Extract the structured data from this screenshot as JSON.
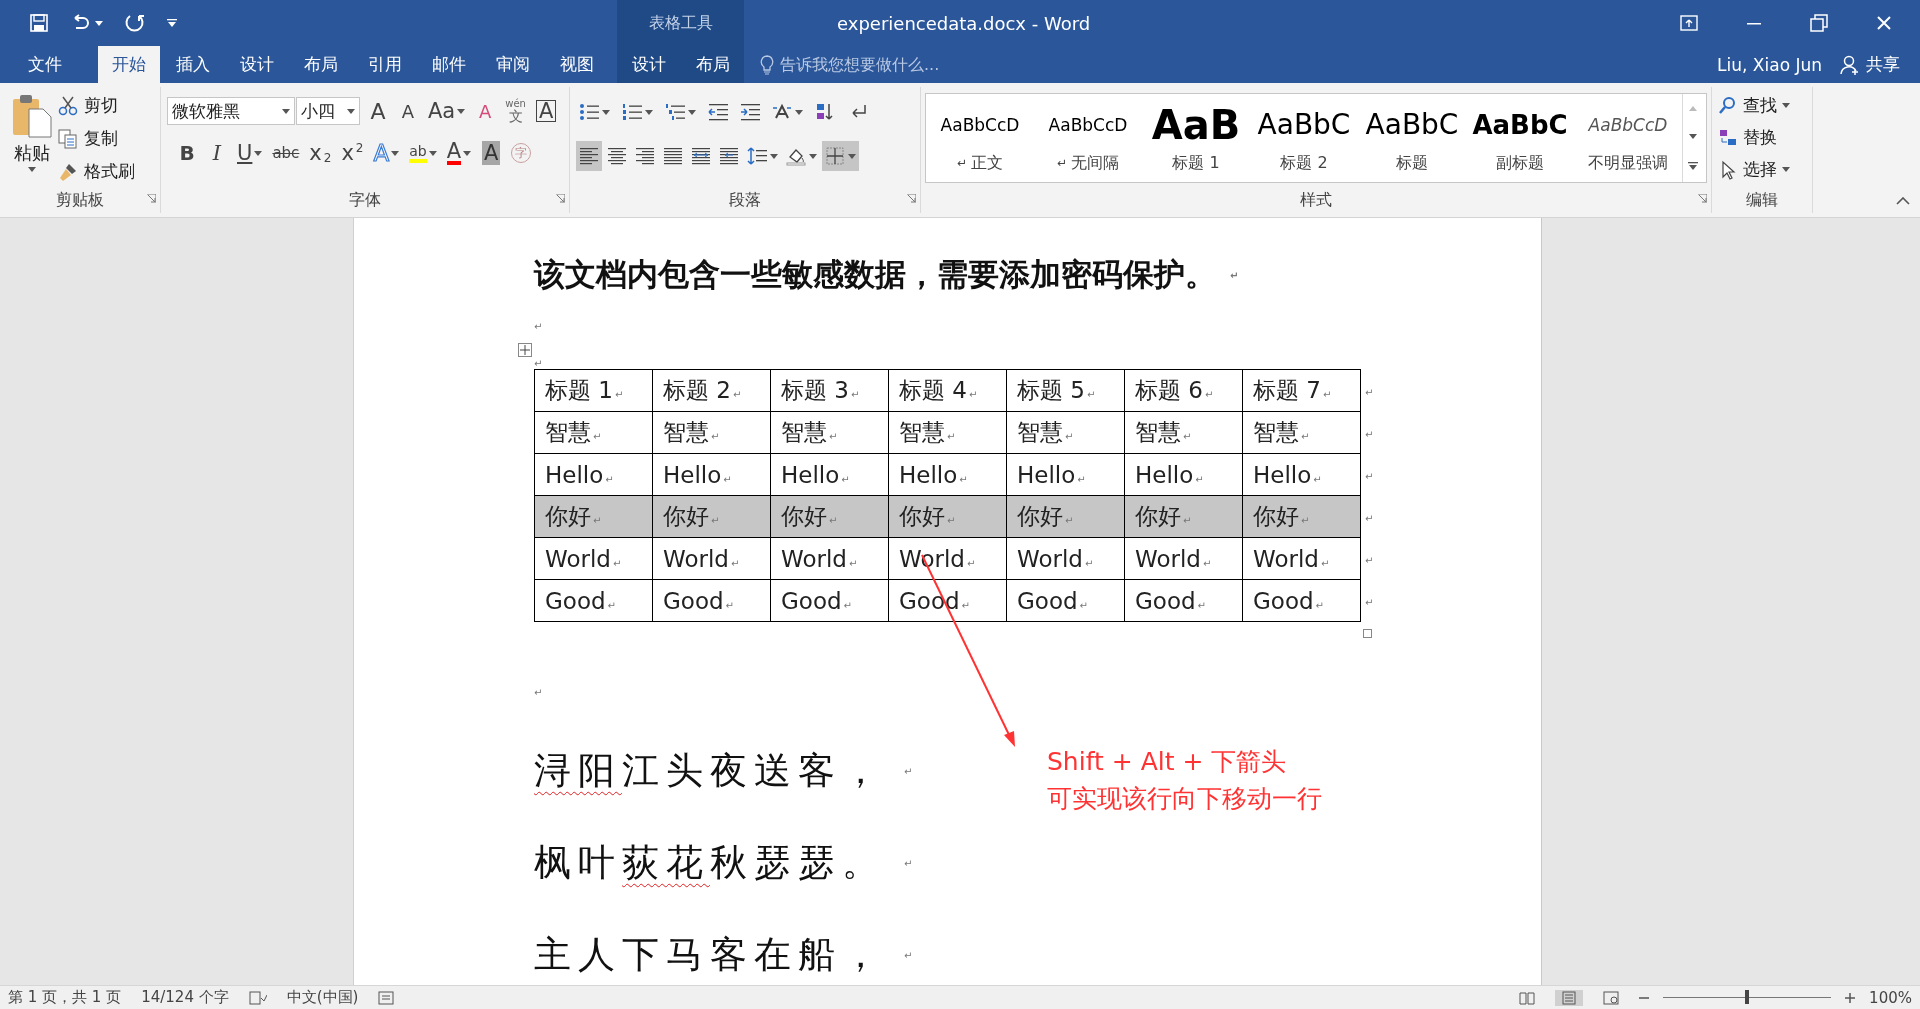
{
  "title_bar": {
    "title": "experiencedata.docx - Word",
    "context_label": "表格工具"
  },
  "menu_tabs": [
    {
      "label": "文件",
      "selected": false,
      "kind": "main"
    },
    {
      "label": "开始",
      "selected": true,
      "kind": "main"
    },
    {
      "label": "插入",
      "selected": false,
      "kind": "main"
    },
    {
      "label": "设计",
      "selected": false,
      "kind": "main"
    },
    {
      "label": "布局",
      "selected": false,
      "kind": "main"
    },
    {
      "label": "引用",
      "selected": false,
      "kind": "main"
    },
    {
      "label": "邮件",
      "selected": false,
      "kind": "main"
    },
    {
      "label": "审阅",
      "selected": false,
      "kind": "main"
    },
    {
      "label": "视图",
      "selected": false,
      "kind": "main"
    },
    {
      "label": "设计",
      "selected": false,
      "kind": "contextual"
    },
    {
      "label": "布局",
      "selected": false,
      "kind": "contextual"
    }
  ],
  "tell_me": {
    "placeholder": "告诉我您想要做什么..."
  },
  "user": {
    "name": "Liu, Xiao Jun",
    "share": "共享"
  },
  "ribbon": {
    "clipboard": {
      "paste": "粘贴",
      "cut": "剪切",
      "copy": "复制",
      "format_painter": "格式刷",
      "group_label": "剪贴板"
    },
    "font": {
      "font_name": "微软雅黑",
      "font_size": "小四",
      "group_label": "字体",
      "row1": [
        {
          "kind": "grow",
          "glyph": "A"
        },
        {
          "kind": "shrink",
          "glyph": "A"
        },
        {
          "kind": "case",
          "glyph": "Aa",
          "dropdown": true
        },
        {
          "kind": "clear",
          "glyph": "A"
        },
        {
          "kind": "phonetic",
          "glyph": "文",
          "ruby": "wén"
        },
        {
          "kind": "border",
          "glyph": "A"
        }
      ],
      "row2": [
        {
          "kind": "bold",
          "glyph": "B"
        },
        {
          "kind": "italic",
          "glyph": "I"
        },
        {
          "kind": "underline",
          "glyph": "U",
          "dropdown": true
        },
        {
          "kind": "strike",
          "glyph": "abc"
        },
        {
          "kind": "subscript",
          "glyph": "x",
          "index": "2"
        },
        {
          "kind": "superscript",
          "glyph": "x",
          "index": "2"
        },
        {
          "kind": "effects",
          "glyph": "A",
          "dropdown": true
        },
        {
          "kind": "highlight",
          "glyph": "ab",
          "dropdown": true
        },
        {
          "kind": "color",
          "glyph": "A",
          "dropdown": true
        },
        {
          "kind": "shading",
          "glyph": "A"
        },
        {
          "kind": "enclose",
          "glyph": "字"
        }
      ]
    },
    "paragraph": {
      "group_label": "段落",
      "row1": [
        {
          "kind": "bullets",
          "dropdown": true
        },
        {
          "kind": "numbering",
          "dropdown": true
        },
        {
          "kind": "multilevel",
          "dropdown": true
        },
        {
          "kind": "outdent",
          "dropdown": false
        },
        {
          "kind": "indent",
          "dropdown": false
        },
        {
          "kind": "asian",
          "dropdown": true
        },
        {
          "kind": "sort",
          "dropdown": false
        },
        {
          "kind": "marks",
          "dropdown": false
        }
      ],
      "row2": [
        {
          "kind": "left",
          "selected": true,
          "dropdown": false
        },
        {
          "kind": "center",
          "selected": false,
          "dropdown": false
        },
        {
          "kind": "right",
          "selected": false,
          "dropdown": false
        },
        {
          "kind": "justify",
          "selected": false,
          "dropdown": false
        },
        {
          "kind": "distributed",
          "selected": false,
          "dropdown": false
        },
        {
          "kind": "columns",
          "selected": false,
          "dropdown": false
        },
        {
          "kind": "spacing",
          "selected": false,
          "dropdown": true
        },
        {
          "kind": "shading",
          "selected": false,
          "dropdown": true
        },
        {
          "kind": "borders",
          "selected": true,
          "dropdown": true
        }
      ]
    },
    "styles": {
      "group_label": "样式",
      "items": [
        {
          "kind": "normal",
          "preview": "AaBbCcD",
          "label": "正文",
          "mark": "↵"
        },
        {
          "kind": "nospacing",
          "preview": "AaBbCcD",
          "label": "无间隔",
          "mark": "↵"
        },
        {
          "kind": "h1",
          "preview": "AaB",
          "label": "标题 1"
        },
        {
          "kind": "h2",
          "preview": "AaBbC",
          "label": "标题 2"
        },
        {
          "kind": "title",
          "preview": "AaBbC",
          "label": "标题"
        },
        {
          "kind": "subtitle",
          "preview": "AaBbC",
          "label": "副标题"
        },
        {
          "kind": "subtle",
          "preview": "AaBbCcD",
          "label": "不明显强调"
        }
      ]
    },
    "editing": {
      "group_label": "编辑",
      "items": [
        {
          "kind": "find",
          "label": "查找",
          "dropdown": true
        },
        {
          "kind": "replace",
          "label": "替换",
          "dropdown": false
        },
        {
          "kind": "select",
          "label": "选择",
          "dropdown": true
        }
      ]
    }
  },
  "document": {
    "heading": "该文档内包含一些敏感数据，需要添加密码保护。",
    "heading_mark": "↵",
    "empty_mark": "↵",
    "table_mark": "↵",
    "table": {
      "rows": [
        {
          "selected": false,
          "end_mark": "↵",
          "cells": [
            [
              "标题 1",
              "↵"
            ],
            [
              "标题 2",
              "↵"
            ],
            [
              "标题 3",
              "↵"
            ],
            [
              "标题 4",
              "↵"
            ],
            [
              "标题 5",
              "↵"
            ],
            [
              "标题 6",
              "↵"
            ],
            [
              "标题 7",
              "↵"
            ]
          ]
        },
        {
          "selected": false,
          "end_mark": "↵",
          "cells": [
            [
              "智慧",
              "↵"
            ],
            [
              "智慧",
              "↵"
            ],
            [
              "智慧",
              "↵"
            ],
            [
              "智慧",
              "↵"
            ],
            [
              "智慧",
              "↵"
            ],
            [
              "智慧",
              "↵"
            ],
            [
              "智慧",
              "↵"
            ]
          ]
        },
        {
          "selected": false,
          "end_mark": "↵",
          "cells": [
            [
              "Hello",
              "↵"
            ],
            [
              "Hello",
              "↵"
            ],
            [
              "Hello",
              "↵"
            ],
            [
              "Hello",
              "↵"
            ],
            [
              "Hello",
              "↵"
            ],
            [
              "Hello",
              "↵"
            ],
            [
              "Hello",
              "↵"
            ]
          ]
        },
        {
          "selected": true,
          "end_mark": "↵",
          "cells": [
            [
              "你好",
              "↵"
            ],
            [
              "你好",
              "↵"
            ],
            [
              "你好",
              "↵"
            ],
            [
              "你好",
              "↵"
            ],
            [
              "你好",
              "↵"
            ],
            [
              "你好",
              "↵"
            ],
            [
              "你好",
              "↵"
            ]
          ]
        },
        {
          "selected": false,
          "end_mark": "↵",
          "cells": [
            [
              "World",
              "↵"
            ],
            [
              "World",
              "↵"
            ],
            [
              "World",
              "↵"
            ],
            [
              "World",
              "↵"
            ],
            [
              "World",
              "↵"
            ],
            [
              "World",
              "↵"
            ],
            [
              "World",
              "↵"
            ]
          ]
        },
        {
          "selected": false,
          "end_mark": "↵",
          "cells": [
            [
              "Good",
              "↵"
            ],
            [
              "Good",
              "↵"
            ],
            [
              "Good",
              "↵"
            ],
            [
              "Good",
              "↵"
            ],
            [
              "Good",
              "↵"
            ],
            [
              "Good",
              "↵"
            ],
            [
              "Good",
              "↵"
            ]
          ]
        }
      ]
    },
    "after_table_mark": "↵",
    "poem": [
      {
        "mark": "↵",
        "segments": [
          {
            "text": "浔阳",
            "misspelled": true
          },
          {
            "text": "江头夜送客，",
            "misspelled": false
          }
        ]
      },
      {
        "mark": "↵",
        "segments": [
          {
            "text": "枫叶",
            "misspelled": false
          },
          {
            "text": "荻花",
            "misspelled": true
          },
          {
            "text": "秋瑟瑟。",
            "misspelled": false
          }
        ]
      },
      {
        "mark": "↵",
        "segments": [
          {
            "text": "主人下马客在船，",
            "misspelled": false
          }
        ]
      }
    ],
    "callout": {
      "lines": [
        "Shift + Alt + 下箭头",
        "可实现该行向下移动一行"
      ]
    }
  },
  "status_bar": {
    "page": "第 1 页，共 1 页",
    "words": "14/124 个字",
    "language": "中文(中国)",
    "views": [
      {
        "kind": "read",
        "selected": false
      },
      {
        "kind": "print",
        "selected": true
      },
      {
        "kind": "web",
        "selected": false
      }
    ],
    "zoom": {
      "level": 0.5,
      "label": "100%"
    }
  }
}
